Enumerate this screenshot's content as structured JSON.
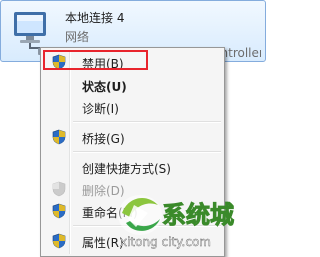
{
  "adapter": {
    "name": "本地连接 4",
    "status": "网络",
    "device": "Realtek PCIe FE Family Controller"
  },
  "menu": {
    "items": [
      {
        "label": "禁用(B)",
        "icon": "shield-icon",
        "bold": false,
        "disabled": false,
        "highlighted": true
      },
      {
        "label": "状态(U)",
        "icon": "",
        "bold": true,
        "disabled": false
      },
      {
        "label": "诊断(I)",
        "icon": "",
        "bold": false,
        "disabled": false
      },
      {
        "label": "桥接(G)",
        "icon": "shield-icon",
        "bold": false,
        "disabled": false
      },
      {
        "label": "创建快捷方式(S)",
        "icon": "",
        "bold": false,
        "disabled": false
      },
      {
        "label": "删除(D)",
        "icon": "shield-icon",
        "bold": false,
        "disabled": true
      },
      {
        "label": "重命名(M)",
        "icon": "shield-icon",
        "bold": false,
        "disabled": false
      },
      {
        "label": "属性(R)",
        "icon": "shield-icon",
        "bold": false,
        "disabled": false
      }
    ]
  },
  "watermark": {
    "text": "系统城",
    "url": "xitong city.com"
  },
  "colors": {
    "highlight_border": "#e8242c",
    "tile_border": "#84acdd",
    "menu_bg": "#f5f5f5"
  }
}
